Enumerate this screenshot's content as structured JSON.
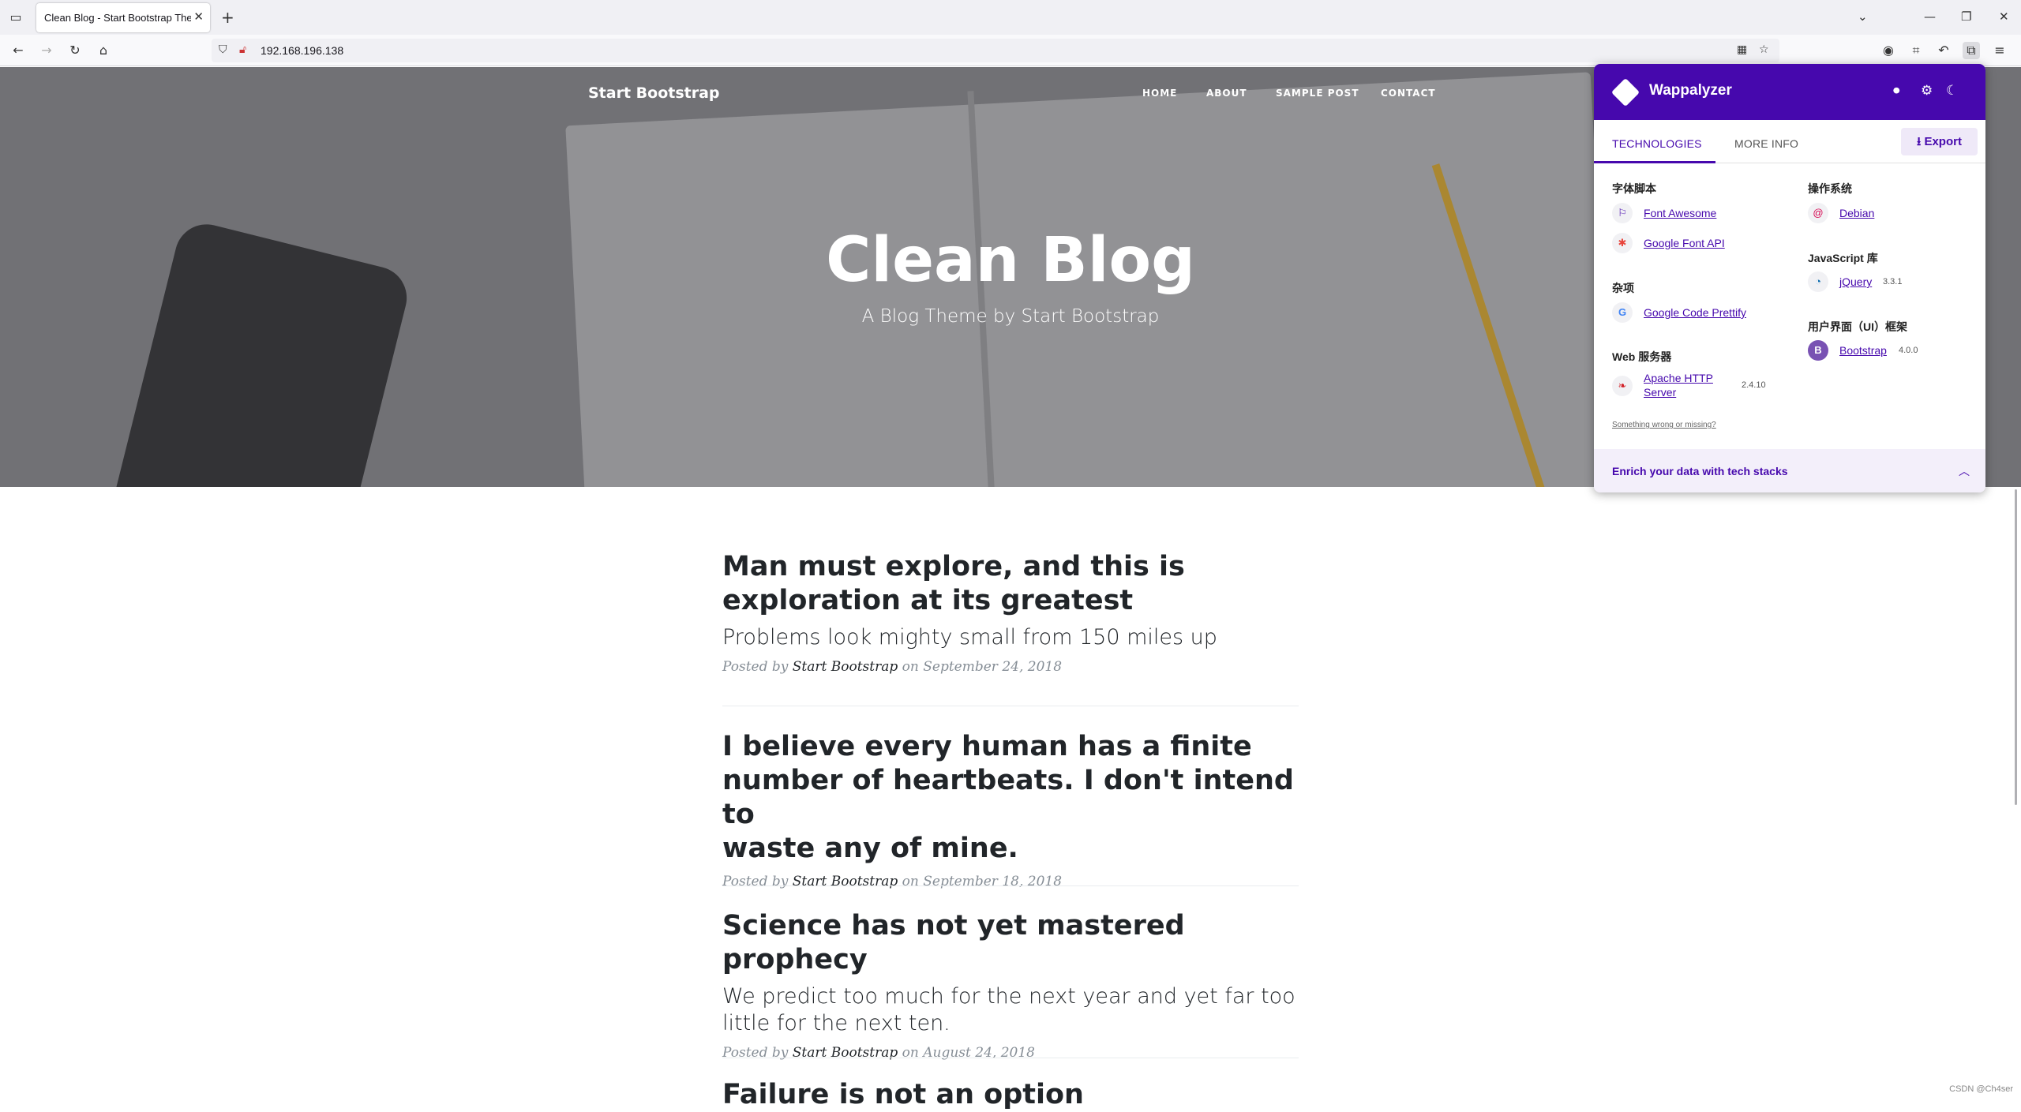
{
  "browser": {
    "tab_title": "Clean Blog - Start Bootstrap The",
    "url": "192.168.196.138"
  },
  "site": {
    "brand": "Start Bootstrap",
    "nav": [
      "HOME",
      "ABOUT",
      "SAMPLE POST",
      "CONTACT"
    ],
    "hero_title": "Clean Blog",
    "hero_subtitle": "A Blog Theme by Start Bootstrap"
  },
  "posts": [
    {
      "title_line1": "Man must explore, and this is",
      "title_line2": "exploration at its greatest",
      "subtitle": "Problems look mighty small from 150 miles up",
      "posted_by": "Posted by",
      "author": "Start Bootstrap",
      "on": "on",
      "date": "September 24, 2018"
    },
    {
      "title_line1": "I believe every human has a finite",
      "title_line2": "number of heartbeats. I don't intend to",
      "title_line3": "waste any of mine.",
      "posted_by": "Posted by",
      "author": "Start Bootstrap",
      "on": "on",
      "date": "September 18, 2018"
    },
    {
      "title_line1": "Science has not yet mastered prophecy",
      "subtitle_line1": "We predict too much for the next year and yet far too",
      "subtitle_line2": "little for the next ten.",
      "posted_by": "Posted by",
      "author": "Start Bootstrap",
      "on": "on",
      "date": "August 24, 2018"
    },
    {
      "title_line1": "Failure is not an option"
    }
  ],
  "wappalyzer": {
    "brand": "Wappalyzer",
    "tab_technologies": "TECHNOLOGIES",
    "tab_more_info": "MORE INFO",
    "export": "Export",
    "categories": {
      "font_scripts": "字体脚本",
      "misc": "杂项",
      "web_servers": "Web 服务器",
      "os": "操作系统",
      "js_libs": "JavaScript 库",
      "ui_frameworks": "用户界面（UI）框架"
    },
    "techs": {
      "font_awesome": {
        "name": "Font Awesome"
      },
      "google_font_api": {
        "name": "Google Font API"
      },
      "google_code_prettify": {
        "name": "Google Code Prettify"
      },
      "apache_line1": "Apache HTTP",
      "apache_line2": "Server",
      "apache_version": "2.4.10",
      "debian": {
        "name": "Debian"
      },
      "jquery": {
        "name": "jQuery",
        "version": "3.3.1"
      },
      "bootstrap": {
        "name": "Bootstrap",
        "version": "4.0.0"
      }
    },
    "something_wrong": "Something wrong or missing?",
    "enrich": "Enrich your data with tech stacks"
  },
  "watermark": "CSDN @Ch4ser",
  "colors": {
    "wappalyzer_purple": "#4608ad",
    "masthead_overlay": "#7c7c80",
    "text_dark": "#212529",
    "meta_gray": "#868e96"
  }
}
